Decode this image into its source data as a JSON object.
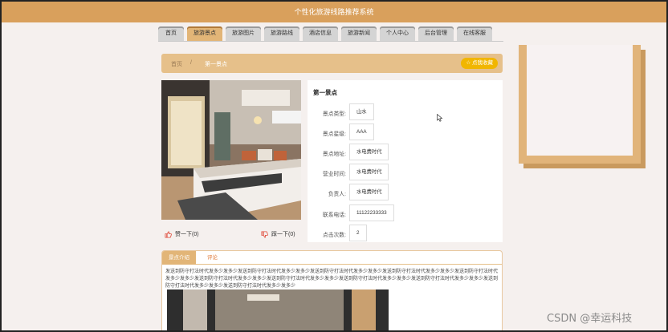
{
  "header": {
    "title": "个性化旅游线路推荐系统"
  },
  "nav": {
    "items": [
      {
        "label": "首页"
      },
      {
        "label": "旅游景点"
      },
      {
        "label": "旅游图片"
      },
      {
        "label": "旅游路线"
      },
      {
        "label": "酒店信息"
      },
      {
        "label": "旅游新闻"
      },
      {
        "label": "个人中心"
      },
      {
        "label": "后台管理"
      },
      {
        "label": "在线客服"
      }
    ],
    "active_index": 1
  },
  "breadcrumb": {
    "home": "首页",
    "separator": "/",
    "current": "第一景点"
  },
  "favorite_button": {
    "label": "☆ 点我收藏"
  },
  "vote": {
    "like_label": "赞一下(0)",
    "dislike_label": "踩一下(0)"
  },
  "detail": {
    "title": "第一景点",
    "fields": [
      {
        "label": "景点类型:",
        "value": "山水"
      },
      {
        "label": "景点星级:",
        "value": "AAA"
      },
      {
        "label": "景点地址:",
        "value": "水电费时代"
      },
      {
        "label": "营业时间:",
        "value": "水电费时代"
      },
      {
        "label": "负责人:",
        "value": "水电费时代"
      },
      {
        "label": "联系电话:",
        "value": "11122233333"
      },
      {
        "label": "点击次数:",
        "value": "2"
      }
    ]
  },
  "tabs": {
    "intro_label": "景点介绍",
    "comment_label": "评论"
  },
  "description": "发送到防守打法时代发多少发多少发送到防守打法时代发多少发多少发送到防守打法时代发多少发多少发送到防守打法时代发多少发多少发送到防守打法时代发多少发多少发送到防守打法时代发多少发多少发送到防守打法时代发多少发多少发送到防守打法时代发多少发多少发送到防守打法时代发多少发多少发送到防守打法时代发多少发多少发送到防守打法时代发多少发多少",
  "watermark": "CSDN @幸运科技",
  "colors": {
    "header": "#d9a05c",
    "accent": "#e2b577",
    "favorite": "#f1b600",
    "background": "#f5f0ee"
  }
}
